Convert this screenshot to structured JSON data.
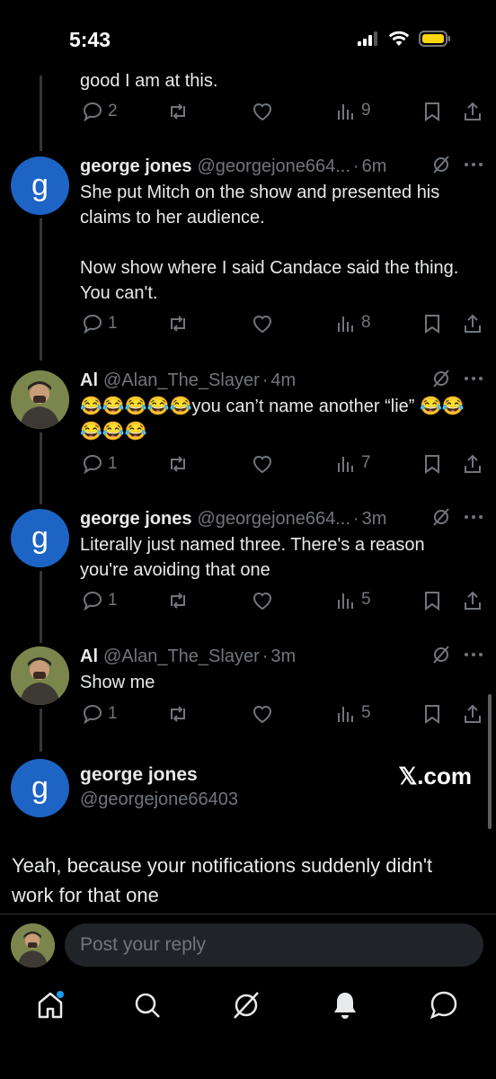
{
  "status_bar": {
    "time": "5:43"
  },
  "top_fragment": {
    "text": "good I am at this.",
    "replies": "2",
    "views": "9"
  },
  "posts": [
    {
      "name": "george jones",
      "handle": "@georgejone664...",
      "time": "6m",
      "text": "She put Mitch on the show and presented his claims to her audience.\n\nNow show where I said Candace said the thing. You can't.",
      "replies": "1",
      "views": "8",
      "avatar_letter": "g"
    },
    {
      "name": "Al",
      "handle": "@Alan_The_Slayer",
      "time": "4m",
      "text": "😂😂😂😂😂you can’t name another “lie” 😂😂😂😂😂",
      "replies": "1",
      "views": "7"
    },
    {
      "name": "george jones",
      "handle": "@georgejone664...",
      "time": "3m",
      "text": "Literally just named three. There's a reason you're avoiding that one",
      "replies": "1",
      "views": "5",
      "avatar_letter": "g"
    },
    {
      "name": "Al",
      "handle": "@Alan_The_Slayer",
      "time": "3m",
      "text": "Show me",
      "replies": "1",
      "views": "5"
    }
  ],
  "main_post": {
    "name": "george jones",
    "handle": "@georgejone66403",
    "avatar_letter": "g",
    "brand": "𝕏.com",
    "text": "Yeah, because your notifications suddenly didn't work for that one"
  },
  "reply_bar": {
    "placeholder": "Post your reply"
  },
  "colors": {
    "background": "#000000",
    "text": "#e7e9ea",
    "muted": "#71767b",
    "avatar_blue": "#1d64c4",
    "accent": "#1d9bf0"
  },
  "tabs": [
    "home-icon",
    "search-icon",
    "grok-icon",
    "notifications-icon",
    "messages-icon"
  ]
}
